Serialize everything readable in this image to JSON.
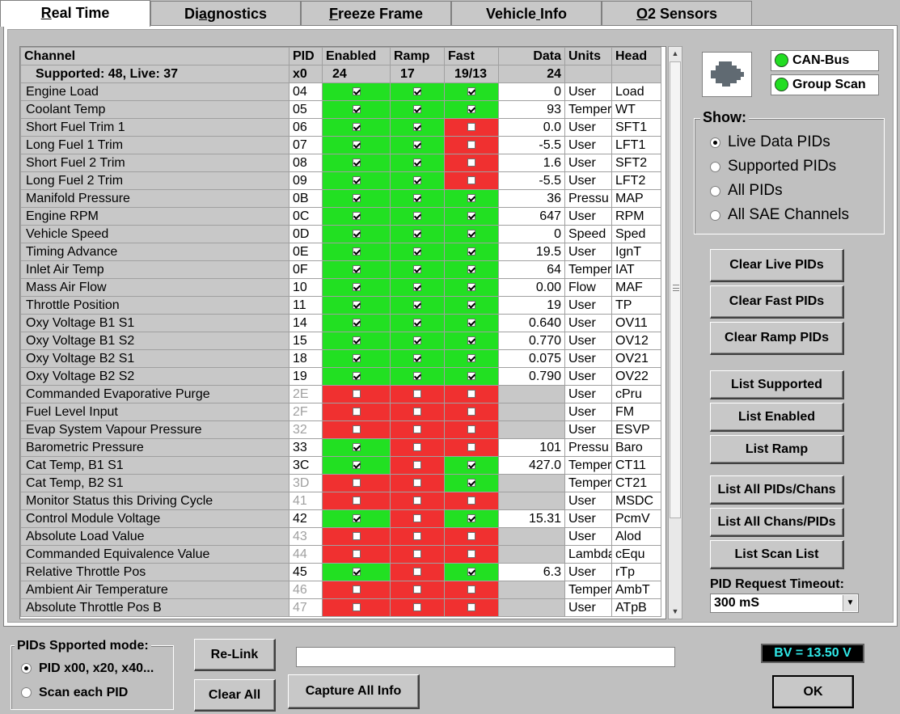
{
  "tabs": [
    {
      "label": "Real Time",
      "active": true
    },
    {
      "label": "Diagnostics"
    },
    {
      "label": "Freeze Frame"
    },
    {
      "label": "Vehicle Info"
    },
    {
      "label": "O2 Sensors"
    }
  ],
  "grid": {
    "columns": [
      "Channel",
      "PID",
      "Enabled",
      "Ramp",
      "Fast",
      "Data",
      "Units",
      "Head"
    ],
    "summary": {
      "channel": "Supported: 48, Live: 37",
      "pid": "x0",
      "enabled": "24",
      "ramp": "17",
      "fast": "19/13",
      "data": "24"
    },
    "rows": [
      {
        "channel": "Engine Load",
        "pid": "04",
        "enabled": true,
        "ramp": true,
        "fast": true,
        "data": "0",
        "units": "User",
        "head": "Load"
      },
      {
        "channel": "Coolant Temp",
        "pid": "05",
        "enabled": true,
        "ramp": true,
        "fast": true,
        "data": "93",
        "units": "Temper",
        "head": "WT"
      },
      {
        "channel": "Short Fuel Trim 1",
        "pid": "06",
        "enabled": true,
        "ramp": true,
        "fast": false,
        "data": "0.0",
        "units": "User",
        "head": "SFT1"
      },
      {
        "channel": "Long Fuel 1 Trim",
        "pid": "07",
        "enabled": true,
        "ramp": true,
        "fast": false,
        "data": "-5.5",
        "units": "User",
        "head": "LFT1"
      },
      {
        "channel": "Short Fuel 2 Trim",
        "pid": "08",
        "enabled": true,
        "ramp": true,
        "fast": false,
        "data": "1.6",
        "units": "User",
        "head": "SFT2"
      },
      {
        "channel": "Long Fuel 2 Trim",
        "pid": "09",
        "enabled": true,
        "ramp": true,
        "fast": false,
        "data": "-5.5",
        "units": "User",
        "head": "LFT2"
      },
      {
        "channel": "Manifold Pressure",
        "pid": "0B",
        "enabled": true,
        "ramp": true,
        "fast": true,
        "data": "36",
        "units": "Pressu",
        "head": "MAP"
      },
      {
        "channel": "Engine RPM",
        "pid": "0C",
        "enabled": true,
        "ramp": true,
        "fast": true,
        "data": "647",
        "units": "User",
        "head": "RPM"
      },
      {
        "channel": "Vehicle Speed",
        "pid": "0D",
        "enabled": true,
        "ramp": true,
        "fast": true,
        "data": "0",
        "units": "Speed",
        "head": "Sped"
      },
      {
        "channel": "Timing Advance",
        "pid": "0E",
        "enabled": true,
        "ramp": true,
        "fast": true,
        "data": "19.5",
        "units": "User",
        "head": "IgnT"
      },
      {
        "channel": "Inlet Air Temp",
        "pid": "0F",
        "enabled": true,
        "ramp": true,
        "fast": true,
        "data": "64",
        "units": "Temper",
        "head": "IAT"
      },
      {
        "channel": "Mass Air Flow",
        "pid": "10",
        "enabled": true,
        "ramp": true,
        "fast": true,
        "data": "0.00",
        "units": "Flow",
        "head": "MAF"
      },
      {
        "channel": "Throttle Position",
        "pid": "11",
        "enabled": true,
        "ramp": true,
        "fast": true,
        "data": "19",
        "units": "User",
        "head": "TP"
      },
      {
        "channel": "Oxy Voltage B1 S1",
        "pid": "14",
        "enabled": true,
        "ramp": true,
        "fast": true,
        "data": "0.640",
        "units": "User",
        "head": "OV11"
      },
      {
        "channel": "Oxy Voltage B1 S2",
        "pid": "15",
        "enabled": true,
        "ramp": true,
        "fast": true,
        "data": "0.770",
        "units": "User",
        "head": "OV12"
      },
      {
        "channel": "Oxy Voltage B2 S1",
        "pid": "18",
        "enabled": true,
        "ramp": true,
        "fast": true,
        "data": "0.075",
        "units": "User",
        "head": "OV21"
      },
      {
        "channel": "Oxy Voltage B2 S2",
        "pid": "19",
        "enabled": true,
        "ramp": true,
        "fast": true,
        "data": "0.790",
        "units": "User",
        "head": "OV22"
      },
      {
        "channel": "Commanded Evaporative Purge",
        "pid": "2E",
        "dim": true,
        "enabled": false,
        "ramp": false,
        "fast": false,
        "data": "",
        "units": "User",
        "head": "cPru"
      },
      {
        "channel": "Fuel Level Input",
        "pid": "2F",
        "dim": true,
        "enabled": false,
        "ramp": false,
        "fast": false,
        "data": "",
        "units": "User",
        "head": "FM"
      },
      {
        "channel": "Evap System Vapour Pressure",
        "pid": "32",
        "dim": true,
        "enabled": false,
        "ramp": false,
        "fast": false,
        "data": "",
        "units": "User",
        "head": "ESVP"
      },
      {
        "channel": "Barometric Pressure",
        "pid": "33",
        "enabled": true,
        "ramp": false,
        "fast": false,
        "data": "101",
        "units": "Pressu",
        "head": "Baro"
      },
      {
        "channel": "Cat Temp, B1 S1",
        "pid": "3C",
        "enabled": true,
        "ramp": false,
        "fast": true,
        "data": "427.0",
        "units": "Temper",
        "head": "CT11"
      },
      {
        "channel": "Cat Temp, B2 S1",
        "pid": "3D",
        "dim": true,
        "enabled": false,
        "ramp": false,
        "fast": true,
        "data": "",
        "units": "Temper",
        "head": "CT21"
      },
      {
        "channel": "Monitor Status this Driving Cycle",
        "pid": "41",
        "dim": true,
        "enabled": false,
        "ramp": false,
        "fast": false,
        "data": "",
        "units": "User",
        "head": "MSDC"
      },
      {
        "channel": "Control Module Voltage",
        "pid": "42",
        "enabled": true,
        "ramp": false,
        "fast": true,
        "data": "15.31",
        "units": "User",
        "head": "PcmV"
      },
      {
        "channel": "Absolute Load Value",
        "pid": "43",
        "dim": true,
        "enabled": false,
        "ramp": false,
        "fast": false,
        "data": "",
        "units": "User",
        "head": "Alod"
      },
      {
        "channel": "Commanded Equivalence Value",
        "pid": "44",
        "dim": true,
        "enabled": false,
        "ramp": false,
        "fast": false,
        "data": "",
        "units": "Lambda",
        "head": "cEqu"
      },
      {
        "channel": "Relative Throttle Pos",
        "pid": "45",
        "enabled": true,
        "ramp": false,
        "fast": true,
        "data": "6.3",
        "units": "User",
        "head": "rTp"
      },
      {
        "channel": "Ambient Air Temperature",
        "pid": "46",
        "dim": true,
        "enabled": false,
        "ramp": false,
        "fast": false,
        "data": "",
        "units": "Temper",
        "head": "AmbT"
      },
      {
        "channel": "Absolute Throttle Pos B",
        "pid": "47",
        "dim": true,
        "enabled": false,
        "ramp": false,
        "fast": false,
        "data": "",
        "units": "User",
        "head": "ATpB"
      }
    ]
  },
  "status": {
    "can_bus": "CAN-Bus",
    "group_scan": "Group Scan",
    "led_color": "#22dd22"
  },
  "show": {
    "title": "Show:",
    "options": [
      "Live Data PIDs",
      "Supported PIDs",
      "All PIDs",
      "All SAE Channels"
    ],
    "selected": 0
  },
  "buttons": {
    "clear_live": "Clear Live PIDs",
    "clear_fast": "Clear Fast PIDs",
    "clear_ramp": "Clear Ramp PIDs",
    "list_supported": "List Supported",
    "list_enabled": "List Enabled",
    "list_ramp": "List Ramp",
    "list_all_pids_chans": "List All PIDs/Chans",
    "list_all_chans_pids": "List All Chans/PIDs",
    "list_scan": "List Scan List",
    "relink": "Re-Link",
    "clear_all": "Clear All",
    "capture": "Capture All Info",
    "ok": "OK"
  },
  "timeout": {
    "label": "PID Request Timeout:",
    "value": "300 mS"
  },
  "mode": {
    "title": "PIDs Spported mode:",
    "options": [
      "PID x00, x20, x40...",
      "Scan each PID"
    ],
    "selected": 0
  },
  "info_text": "",
  "battery": {
    "text": "BV = 13.50 V",
    "color": "#30e8e8"
  }
}
